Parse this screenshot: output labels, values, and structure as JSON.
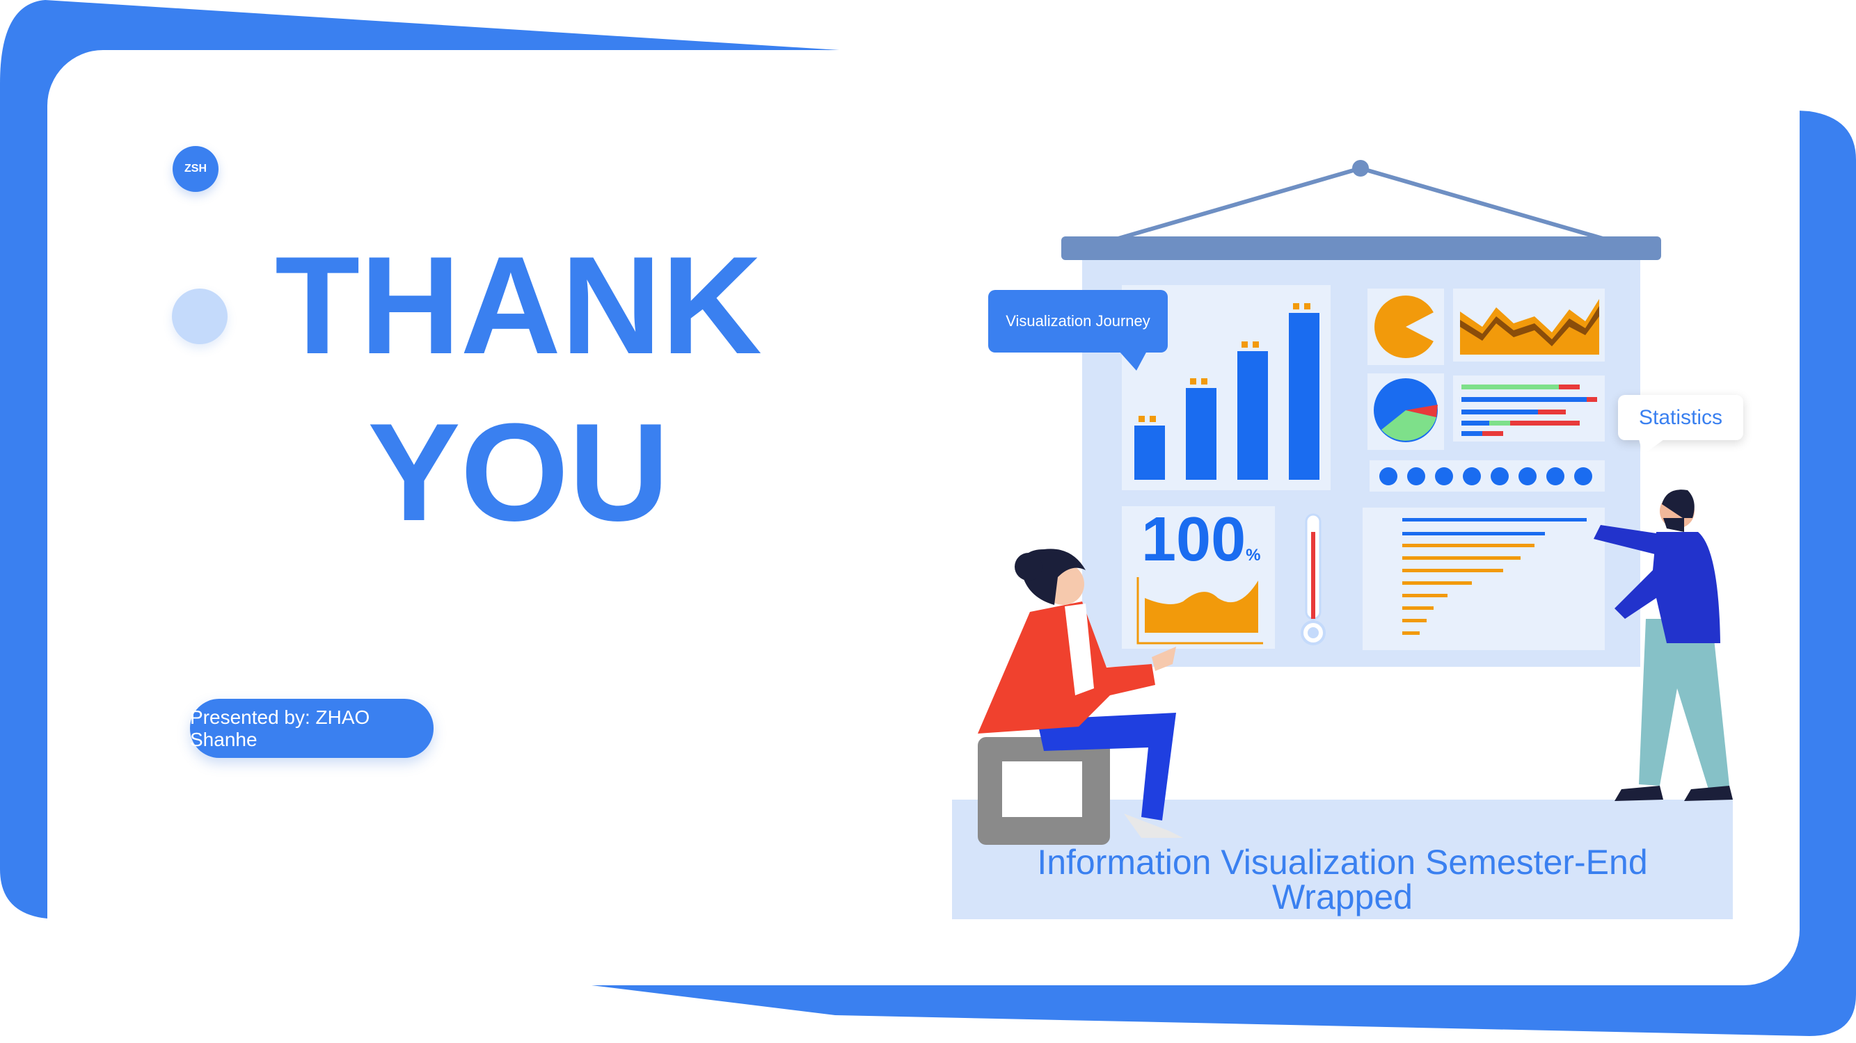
{
  "badge": {
    "text": "ZSH"
  },
  "headline": {
    "line1": "THANK",
    "line2": "YOU"
  },
  "presenter": {
    "label": "Presented by: ZHAO Shanhe"
  },
  "illustration": {
    "bubble_left": "Visualization Journey",
    "bubble_right": "Statistics",
    "gauge_value": "100",
    "gauge_unit": "%"
  },
  "subtitle": {
    "line1": "Information Visualization Semester-End",
    "line2": "Wrapped"
  },
  "colors": {
    "accent": "#3a80f0",
    "light": "#c4dafb",
    "orange": "#f29a0b",
    "panel": "#d6e4fa"
  }
}
